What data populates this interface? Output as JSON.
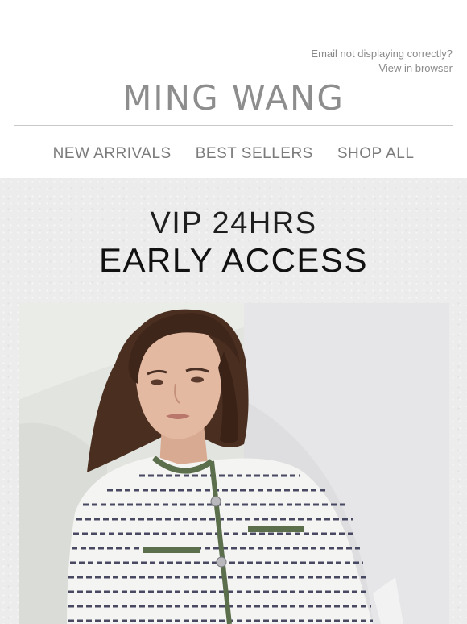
{
  "preheader": {
    "message": "Email not displaying correctly?",
    "link_label": "View in browser"
  },
  "brand": {
    "name": "MING WANG"
  },
  "nav": {
    "items": [
      {
        "label": "NEW ARRIVALS"
      },
      {
        "label": "BEST SELLERS"
      },
      {
        "label": "SHOP ALL"
      }
    ]
  },
  "hero": {
    "line1": "VIP 24HRS",
    "line2": "EARLY ACCESS",
    "image": "model wearing white tweed jacket with green trim"
  },
  "colors": {
    "logo": "#8d8d8d",
    "nav": "#7b7b7b",
    "hero_bg": "#ececec",
    "jacket_trim": "#5b6f4c"
  }
}
